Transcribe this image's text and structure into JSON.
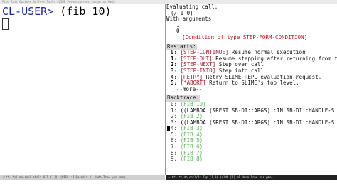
{
  "menubar": {
    "text": "File Edit Options Buffers Tools SLIME Presentations Inspector Help"
  },
  "repl": {
    "prompt": "CL-USER>",
    "input": "(fib 10)"
  },
  "sldb": {
    "evaluating_label": "Evaluating call:",
    "call": "(/ 1 0)",
    "with_args_label": "With arguments:",
    "args": [
      "1",
      "0"
    ],
    "condition": "[Condition of type STEP-FORM-CONDITION]",
    "restarts_label": "Restarts:",
    "restarts": [
      {
        "num": "0:",
        "name": "[STEP-CONTINUE]",
        "desc": " Resume normal execution"
      },
      {
        "num": "1:",
        "name": "[STEP-OUT]",
        "desc": " Resume stepping after returning from t"
      },
      {
        "num": "2:",
        "name": "[STEP-NEXT]",
        "desc": " Step over call"
      },
      {
        "num": "3:",
        "name": "[STEP-INTO]",
        "desc": " Step into call"
      },
      {
        "num": "4:",
        "name": "[RETRY]",
        "desc": " Retry SLIME REPL evaluation request."
      },
      {
        "num": "5:",
        "name": "[*ABORT]",
        "desc": " Return to SLIME's top level."
      }
    ],
    "more": "--more--",
    "backtrace_label": "Backtrace:",
    "backtrace": [
      {
        "num": "0:",
        "text": "(FIB 10)",
        "dim": true
      },
      {
        "num": "1:",
        "text": "((LAMBDA (&REST SB-DI::ARGS) :IN SB-DI::HANDLE-S",
        "dim": false
      },
      {
        "num": "2:",
        "text": "(FIB 2)",
        "dim": true
      },
      {
        "num": "3:",
        "text": "((LAMBDA (&REST SB-DI::ARGS) :IN SB-DI::HANDLE-S",
        "dim": false
      },
      {
        "num": "4:",
        "text": "(FIB 3)",
        "dim": true
      },
      {
        "num": "5:",
        "text": "(FIB 4)",
        "dim": true
      },
      {
        "num": "6:",
        "text": "(FIB 5)",
        "dim": true
      },
      {
        "num": "7:",
        "text": "(FIB 6)",
        "dim": true
      },
      {
        "num": "8:",
        "text": "(FIB 7)",
        "dim": true
      },
      {
        "num": "9:",
        "text": "(FIB 8)",
        "dim": true
      }
    ]
  },
  "modeline_left": {
    "text": "-:**-  *slime-repl sbcl*   All (1,0)   (REPL :4 Paredit el Undo-Tree yas pmo)"
  },
  "modeline_right": {
    "text": "-:%*-  *sldb sbcl/1*   Top (1,0)   (sldb [1] el Undo-Tree yas pmo)"
  },
  "colors": {
    "prompt": "#1d2a9e",
    "condition": "#b2101a",
    "restart_name": "#a01a2a",
    "frame_dim": "#5cb05c"
  }
}
